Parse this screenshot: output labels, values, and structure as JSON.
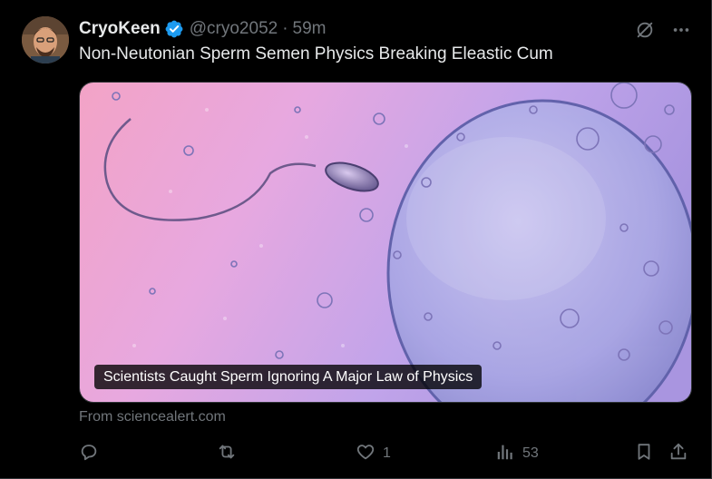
{
  "tweet": {
    "author": {
      "display_name": "CryoKeen",
      "handle": "@cryo2052",
      "verified": true
    },
    "separator": "·",
    "time": "59m",
    "text": "Non-Neutonian Sperm Semen Physics Breaking Eleastic Cum",
    "card": {
      "title": "Scientists Caught Sperm Ignoring A Major Law of Physics",
      "source": "From sciencealert.com"
    },
    "stats": {
      "replies": "",
      "reposts": "",
      "likes": "1",
      "views": "53"
    }
  },
  "colors": {
    "background": "#000000",
    "text": "#e7e9ea",
    "muted": "#71767b",
    "verified": "#1d9bf0"
  },
  "icons": [
    "grok-icon",
    "more-icon",
    "reply-icon",
    "repost-icon",
    "like-icon",
    "views-icon",
    "bookmark-icon",
    "share-icon",
    "verified-badge-icon"
  ]
}
